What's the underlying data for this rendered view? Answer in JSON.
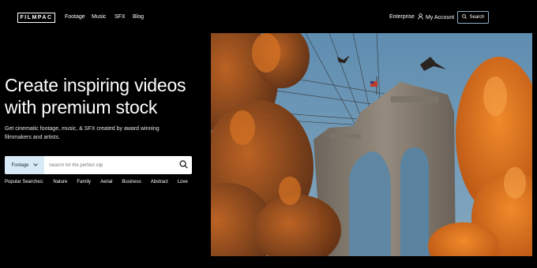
{
  "nav": {
    "logo_text": "FILMPAC",
    "links": [
      "Footage",
      "Music",
      "SFX",
      "Blog"
    ],
    "enterprise": "Enterprise",
    "account": "My Account",
    "search_label": "Search"
  },
  "hero": {
    "title_line1": "Create inspiring videos",
    "title_line2": "with premium stock",
    "subtitle": "Get cinematic footage, music, & SFX created by award winning filmmakers and artists."
  },
  "search": {
    "type_value": "Footage",
    "placeholder": "Search for the perfect clip"
  },
  "popular": {
    "label": "Popular Searches:",
    "items": [
      "Nature",
      "Family",
      "Aerial",
      "Business",
      "Abstract",
      "Love"
    ]
  },
  "icons": {
    "account": "user-icon",
    "search": "search-icon",
    "dropdown": "chevron-down-icon"
  },
  "colors": {
    "background": "#000000",
    "search_type_bg": "#d7eaf5",
    "search_button_border": "#8fb0c8",
    "sky": "#6a91ad",
    "foliage": "#e07a24",
    "stone": "#8a8278"
  }
}
